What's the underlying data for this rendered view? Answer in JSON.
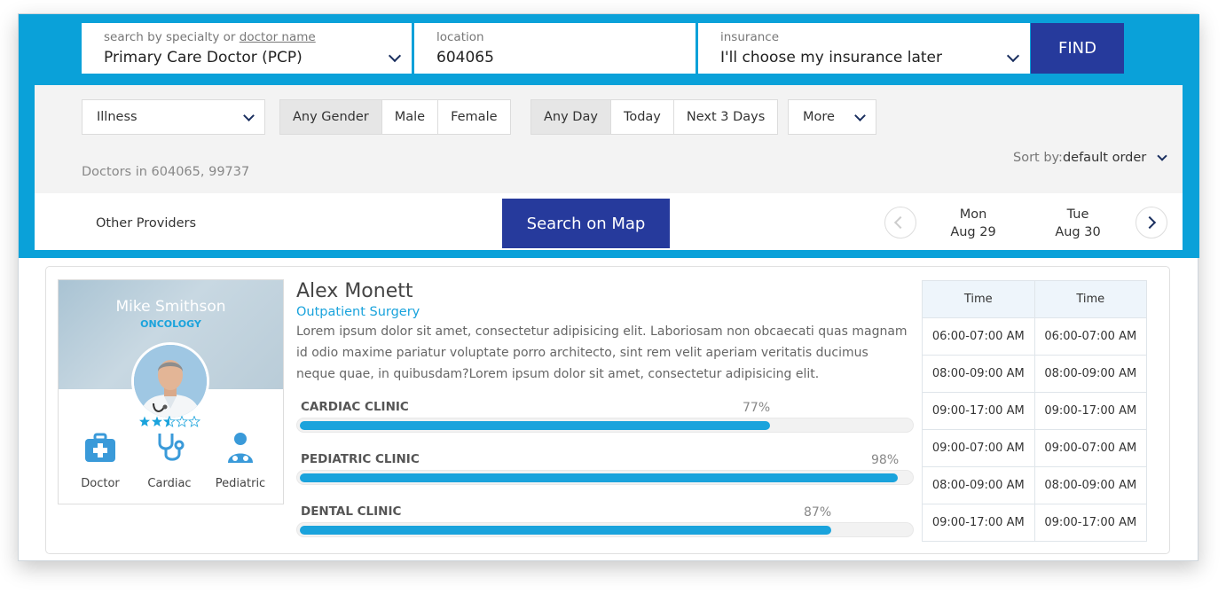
{
  "search": {
    "specialty_label_prefix": "search by specialty or",
    "specialty_label_link": "doctor name",
    "specialty_value": "Primary Care Doctor (PCP)",
    "location_label": "location",
    "location_value": "604065",
    "insurance_label": "insurance",
    "insurance_value": "I'll choose my insurance later",
    "find_label": "FIND"
  },
  "filters": {
    "illness": "Illness",
    "gender": [
      "Any Gender",
      "Male",
      "Female"
    ],
    "day": [
      "Any Day",
      "Today",
      "Next 3 Days"
    ],
    "more": "More",
    "results_text": "Doctors in 604065, 99737",
    "sort_key": "Sort by:",
    "sort_value": "default order"
  },
  "providers": {
    "other_label": "Other Providers",
    "map_button": "Search on Map",
    "days": [
      {
        "dow": "Mon",
        "date": "Aug 29"
      },
      {
        "dow": "Tue",
        "date": "Aug 30"
      }
    ]
  },
  "profile": {
    "name": "Mike Smithson",
    "specialty": "ONCOLOGY",
    "rating": 2.5,
    "rating_max": 5,
    "services": [
      {
        "icon": "medical-kit-icon",
        "label": "Doctor"
      },
      {
        "icon": "stethoscope-icon",
        "label": "Cardiac"
      },
      {
        "icon": "pediatric-icon",
        "label": "Pediatric"
      }
    ]
  },
  "doctor": {
    "name": "Alex Monett",
    "department": "Outpatient Surgery",
    "bio": "Lorem ipsum dolor sit amet, consectetur adipisicing elit. Laboriosam non obcaecati quas magnam id odio maxime pariatur voluptate porro architecto, sint rem velit aperiam veritatis ducimus neque quae, in quibusdam?Lorem ipsum dolor sit amet, consectetur adipisicing elit.",
    "clinics": [
      {
        "name": "CARDIAC CLINIC",
        "percent": 77,
        "percent_label": "77%"
      },
      {
        "name": "PEDIATRIC CLINIC",
        "percent": 98,
        "percent_label": "98%"
      },
      {
        "name": "DENTAL CLINIC",
        "percent": 87,
        "percent_label": "87%"
      }
    ]
  },
  "schedule": {
    "headers": [
      "Time",
      "Time"
    ],
    "rows": [
      [
        "06:00-07:00 AM",
        "06:00-07:00 AM"
      ],
      [
        "08:00-09:00 AM",
        "08:00-09:00 AM"
      ],
      [
        "09:00-17:00 AM",
        "09:00-17:00 AM"
      ],
      [
        "09:00-07:00 AM",
        "09:00-07:00 AM"
      ],
      [
        "08:00-09:00 AM",
        "08:00-09:00 AM"
      ],
      [
        "09:00-17:00 AM",
        "09:00-17:00 AM"
      ]
    ]
  },
  "colors": {
    "accent": "#0aa1d9",
    "primary_button": "#263a9c",
    "progress": "#1aa3dc"
  }
}
